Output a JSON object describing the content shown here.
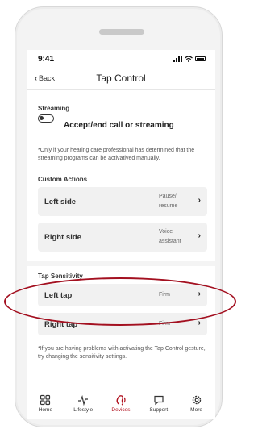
{
  "status": {
    "time": "9:41"
  },
  "nav": {
    "back_label": "Back",
    "title": "Tap Control"
  },
  "streaming": {
    "section_title": "Streaming",
    "toggle_label": "Accept/end call or streaming",
    "toggle_on": false,
    "note": "*Only if your hearing care professional has determined that the streaming programs can be activatived manually."
  },
  "custom_actions": {
    "section_title": "Custom Actions",
    "rows": [
      {
        "label": "Left side",
        "value_line1": "Pause/",
        "value_line2": "resume"
      },
      {
        "label": "Right side",
        "value_line1": "Voice",
        "value_line2": "assistant"
      }
    ]
  },
  "tap_sensitivity": {
    "section_title": "Tap Sensitivity",
    "rows": [
      {
        "label": "Left tap",
        "value": "Firm"
      },
      {
        "label": "Right tap",
        "value": "Firm"
      }
    ],
    "note": "*If you are having problems with activating the Tap Control gesture, try changing the sensitivity settings."
  },
  "tabs": [
    {
      "label": "Home",
      "icon": "grid-icon"
    },
    {
      "label": "Lifestyle",
      "icon": "activity-icon"
    },
    {
      "label": "Devices",
      "icon": "hearing-aid-icon"
    },
    {
      "label": "Support",
      "icon": "chat-icon"
    },
    {
      "label": "More",
      "icon": "gear-icon"
    }
  ],
  "colors": {
    "accent": "#b0101e",
    "highlight_ring": "#a31020"
  }
}
